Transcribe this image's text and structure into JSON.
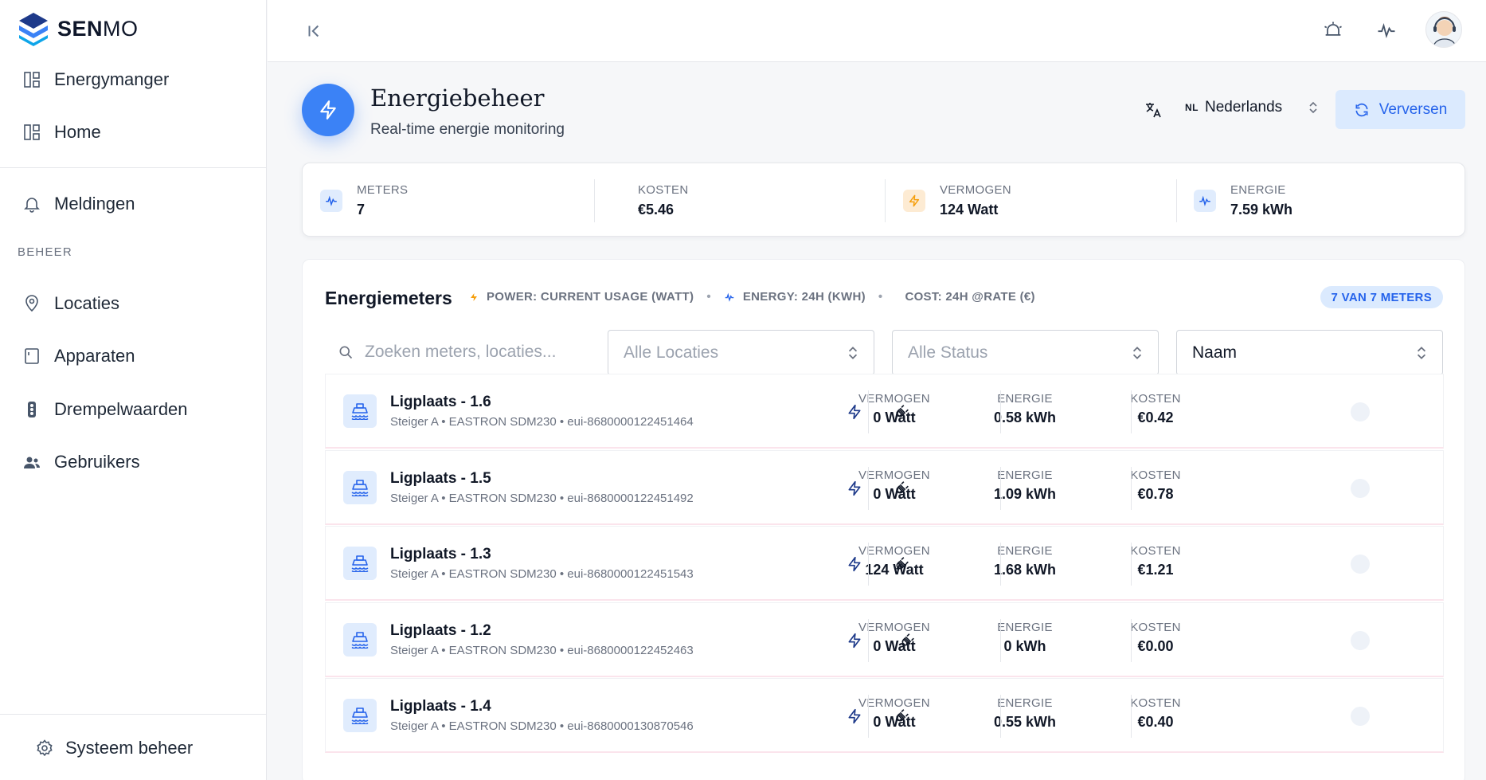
{
  "brand": {
    "name_bold": "SEN",
    "name_light": "MO"
  },
  "sidebar": {
    "items": [
      {
        "label": "Energymanger",
        "icon": "dashboard-icon"
      },
      {
        "label": "Home",
        "icon": "dashboard-icon"
      },
      {
        "label": "Meldingen",
        "icon": "bell-icon"
      }
    ],
    "section_label": "BEHEER",
    "manage_items": [
      {
        "label": "Locaties",
        "icon": "location-icon"
      },
      {
        "label": "Apparaten",
        "icon": "device-icon"
      },
      {
        "label": "Drempelwaarden",
        "icon": "traffic-light-icon"
      },
      {
        "label": "Gebruikers",
        "icon": "users-icon"
      }
    ],
    "system_label": "Systeem beheer"
  },
  "header": {
    "title": "Energiebeheer",
    "subtitle": "Real-time energie monitoring",
    "language_code": "NL",
    "language": "Nederlands",
    "refresh_label": "Verversen"
  },
  "stats": {
    "meters": {
      "label": "METERS",
      "value": "7"
    },
    "costs": {
      "label": "KOSTEN",
      "value": "€5.46"
    },
    "power": {
      "label": "VERMOGEN",
      "value": "124 Watt"
    },
    "energy": {
      "label": "ENERGIE",
      "value": "7.59 kWh"
    }
  },
  "panel": {
    "title": "Energiemeters",
    "legend_power": "POWER: CURRENT USAGE (WATT)",
    "legend_energy": "ENERGY: 24H (KWH)",
    "legend_cost": "COST: 24H @RATE (€)",
    "count_badge": "7 VAN 7 METERS",
    "search_placeholder": "Zoeken meters, locaties...",
    "filter_location": "Alle Locaties",
    "filter_status": "Alle Status",
    "sort": "Naam"
  },
  "columns": {
    "power": "VERMOGEN",
    "energy": "ENERGIE",
    "cost": "KOSTEN"
  },
  "meters": [
    {
      "name": "Ligplaats - 1.6",
      "sub": "Steiger A • EASTRON SDM230 • eui-8680000122451464",
      "power": "0 Watt",
      "energy": "0.58 kWh",
      "cost": "€0.42"
    },
    {
      "name": "Ligplaats - 1.5",
      "sub": "Steiger A • EASTRON SDM230 • eui-8680000122451492",
      "power": "0 Watt",
      "energy": "1.09 kWh",
      "cost": "€0.78"
    },
    {
      "name": "Ligplaats - 1.3",
      "sub": "Steiger A • EASTRON SDM230 • eui-8680000122451543",
      "power": "124 Watt",
      "energy": "1.68 kWh",
      "cost": "€1.21"
    },
    {
      "name": "Ligplaats - 1.2",
      "sub": "Steiger A • EASTRON SDM230 • eui-8680000122452463",
      "power": "0 Watt",
      "energy": "0 kWh",
      "cost": "€0.00"
    },
    {
      "name": "Ligplaats - 1.4",
      "sub": "Steiger A • EASTRON SDM230 • eui-8680000130870546",
      "power": "0 Watt",
      "energy": "0.55 kWh",
      "cost": "€0.40"
    }
  ],
  "colors": {
    "accent": "#3b82f6",
    "accent_soft": "#dbeafe",
    "power_icon": "#f59e0b"
  }
}
